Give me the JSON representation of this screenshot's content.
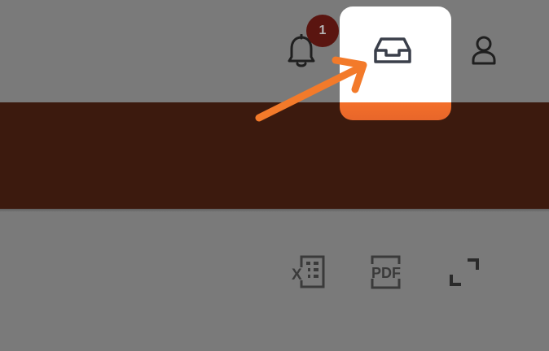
{
  "header": {
    "notifications": {
      "icon": "bell-icon",
      "badge_count": "1"
    },
    "inbox": {
      "icon": "inbox-icon"
    },
    "profile": {
      "icon": "user-icon"
    }
  },
  "toolbar": {
    "export_excel": {
      "icon": "excel-export-icon",
      "label": "X"
    },
    "export_pdf": {
      "icon": "pdf-export-icon",
      "label": "PDF"
    },
    "fullscreen": {
      "icon": "expand-icon"
    }
  },
  "annotation": {
    "icon": "pointer-arrow-icon"
  },
  "colors": {
    "page_gray": "#7a7a7a",
    "band": "#3c1a0e",
    "badge": "#5a1510",
    "highlight": "#ffffff",
    "accent_orange": "#f36f2a",
    "icon_dark": "#3a3a3a"
  }
}
